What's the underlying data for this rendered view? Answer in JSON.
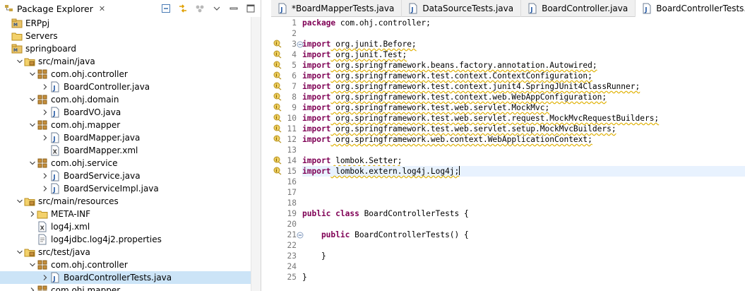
{
  "explorer": {
    "title": "Package Explorer",
    "close_glyph": "✕",
    "toolbar": [
      {
        "name": "collapse-all-icon"
      },
      {
        "name": "link-with-editor-icon"
      },
      {
        "name": "focus-icon"
      },
      {
        "name": "view-menu-icon"
      },
      {
        "name": "minimize-icon"
      },
      {
        "name": "maximize-icon"
      }
    ],
    "tree": [
      {
        "label": "ERPpj",
        "depth": 0,
        "arrow": "",
        "icon": "project-icon"
      },
      {
        "label": "Servers",
        "depth": 0,
        "arrow": "",
        "icon": "folder-icon"
      },
      {
        "label": "springboard",
        "depth": 0,
        "arrow": "",
        "icon": "project-icon"
      },
      {
        "label": "src/main/java",
        "depth": 1,
        "arrow": "v",
        "icon": "source-folder-icon"
      },
      {
        "label": "com.ohj.controller",
        "depth": 2,
        "arrow": "v",
        "icon": "package-icon"
      },
      {
        "label": "BoardController.java",
        "depth": 3,
        "arrow": ">",
        "icon": "java-file-icon"
      },
      {
        "label": "com.ohj.domain",
        "depth": 2,
        "arrow": "v",
        "icon": "package-icon"
      },
      {
        "label": "BoardVO.java",
        "depth": 3,
        "arrow": ">",
        "icon": "java-file-icon"
      },
      {
        "label": "com.ohj.mapper",
        "depth": 2,
        "arrow": "v",
        "icon": "package-icon"
      },
      {
        "label": "BoardMapper.java",
        "depth": 3,
        "arrow": ">",
        "icon": "java-file-icon"
      },
      {
        "label": "BoardMapper.xml",
        "depth": 3,
        "arrow": "",
        "icon": "xml-file-icon"
      },
      {
        "label": "com.ohj.service",
        "depth": 2,
        "arrow": "v",
        "icon": "package-icon"
      },
      {
        "label": "BoardService.java",
        "depth": 3,
        "arrow": ">",
        "icon": "java-file-icon"
      },
      {
        "label": "BoardServiceImpl.java",
        "depth": 3,
        "arrow": ">",
        "icon": "java-file-icon"
      },
      {
        "label": "src/main/resources",
        "depth": 1,
        "arrow": "v",
        "icon": "source-folder-icon"
      },
      {
        "label": "META-INF",
        "depth": 2,
        "arrow": ">",
        "icon": "folder-icon"
      },
      {
        "label": "log4j.xml",
        "depth": 2,
        "arrow": "",
        "icon": "xml-file-icon"
      },
      {
        "label": "log4jdbc.log4j2.properties",
        "depth": 2,
        "arrow": "",
        "icon": "properties-file-icon"
      },
      {
        "label": "src/test/java",
        "depth": 1,
        "arrow": "v",
        "icon": "source-folder-icon"
      },
      {
        "label": "com.ohj.controller",
        "depth": 2,
        "arrow": "v",
        "icon": "package-icon"
      },
      {
        "label": "BoardControllerTests.java",
        "depth": 3,
        "arrow": ">",
        "icon": "java-file-icon",
        "selected": true
      },
      {
        "label": "com.ohj.mapper",
        "depth": 2,
        "arrow": ">",
        "icon": "package-icon"
      }
    ]
  },
  "editor": {
    "tabs": [
      {
        "label": "*BoardMapperTests.java",
        "active": false
      },
      {
        "label": "DataSourceTests.java",
        "active": false
      },
      {
        "label": "BoardController.java",
        "active": false
      },
      {
        "label": "BoardControllerTests.java",
        "active": true
      }
    ],
    "tab_close_glyph": "✕",
    "lines": [
      {
        "n": "1",
        "kw": "package",
        "rest": " com.ohj.controller;",
        "marker": false,
        "fold": false
      },
      {
        "n": "2",
        "kw": "",
        "rest": "",
        "marker": false,
        "fold": false
      },
      {
        "n": "3",
        "kw": "import",
        "rest": " org.junit.Before;",
        "marker": true,
        "fold": true
      },
      {
        "n": "4",
        "kw": "import",
        "rest": " org.junit.Test;",
        "marker": true,
        "fold": false
      },
      {
        "n": "5",
        "kw": "import",
        "rest": " org.springframework.beans.factory.annotation.Autowired;",
        "marker": true,
        "fold": false
      },
      {
        "n": "6",
        "kw": "import",
        "rest": " org.springframework.test.context.ContextConfiguration;",
        "marker": true,
        "fold": false
      },
      {
        "n": "7",
        "kw": "import",
        "rest": " org.springframework.test.context.junit4.SpringJUnit4ClassRunner;",
        "marker": true,
        "fold": false
      },
      {
        "n": "8",
        "kw": "import",
        "rest": " org.springframework.test.context.web.WebAppConfiguration;",
        "marker": true,
        "fold": false
      },
      {
        "n": "9",
        "kw": "import",
        "rest": " org.springframework.test.web.servlet.MockMvc;",
        "marker": true,
        "fold": false
      },
      {
        "n": "10",
        "kw": "import",
        "rest": " org.springframework.test.web.servlet.request.MockMvcRequestBuilders;",
        "marker": true,
        "fold": false
      },
      {
        "n": "11",
        "kw": "import",
        "rest": " org.springframework.test.web.servlet.setup.MockMvcBuilders;",
        "marker": true,
        "fold": false
      },
      {
        "n": "12",
        "kw": "import",
        "rest": " org.springframework.web.context.WebApplicationContext;",
        "marker": true,
        "fold": false
      },
      {
        "n": "13",
        "kw": "",
        "rest": "",
        "marker": false,
        "fold": false
      },
      {
        "n": "14",
        "kw": "import",
        "rest": " lombok.Setter;",
        "marker": true,
        "fold": false
      },
      {
        "n": "15",
        "kw": "import",
        "rest": " lombok.extern.log4j.Log4j;",
        "marker": true,
        "fold": false,
        "current": true
      },
      {
        "n": "16",
        "kw": "",
        "rest": "",
        "marker": false,
        "fold": false
      },
      {
        "n": "17",
        "kw": "",
        "rest": "",
        "marker": false,
        "fold": false
      },
      {
        "n": "18",
        "kw": "",
        "rest": "",
        "marker": false,
        "fold": false
      },
      {
        "n": "19",
        "kw": "public class",
        "rest": " BoardControllerTests {",
        "marker": false,
        "fold": false
      },
      {
        "n": "20",
        "kw": "",
        "rest": "",
        "marker": false,
        "fold": false
      },
      {
        "n": "21",
        "kw": "    public",
        "rest": " BoardControllerTests() {",
        "marker": false,
        "fold": true
      },
      {
        "n": "22",
        "kw": "",
        "rest": "",
        "marker": false,
        "fold": false
      },
      {
        "n": "23",
        "kw": "",
        "rest": "    }",
        "marker": false,
        "fold": false
      },
      {
        "n": "24",
        "kw": "",
        "rest": "",
        "marker": false,
        "fold": false
      },
      {
        "n": "25",
        "kw": "",
        "rest": "}",
        "marker": false,
        "fold": false
      }
    ]
  }
}
